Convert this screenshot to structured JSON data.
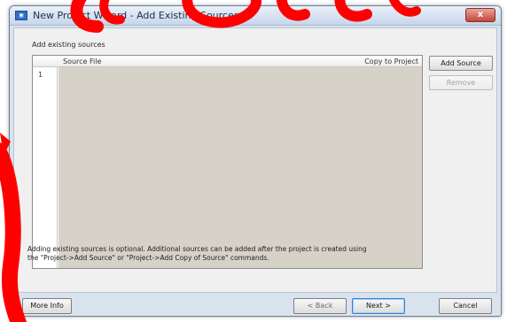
{
  "window": {
    "title": "New Project Wizard - Add Existing Sources",
    "close_label": "x",
    "icon": "xilinx-ise-icon"
  },
  "section_label": "Add existing sources",
  "table": {
    "columns": [
      "Source File",
      "Copy to Project"
    ],
    "rows": [
      {
        "num": "1",
        "source_file": "",
        "copy_to_project": ""
      }
    ]
  },
  "side_buttons": {
    "add_source": "Add Source",
    "remove": "Remove"
  },
  "info": {
    "line1": "Adding existing sources is optional. Additional sources can be added after the project is created using",
    "line2": "the \"Project->Add Source\" or \"Project->Add Copy of Source\" commands."
  },
  "footer": {
    "more_info": "More Info",
    "back": "< Back",
    "next": "Next >",
    "cancel": "Cancel"
  },
  "colors": {
    "decoration": "#ff0000",
    "grid_body": "#d7d2c8"
  }
}
